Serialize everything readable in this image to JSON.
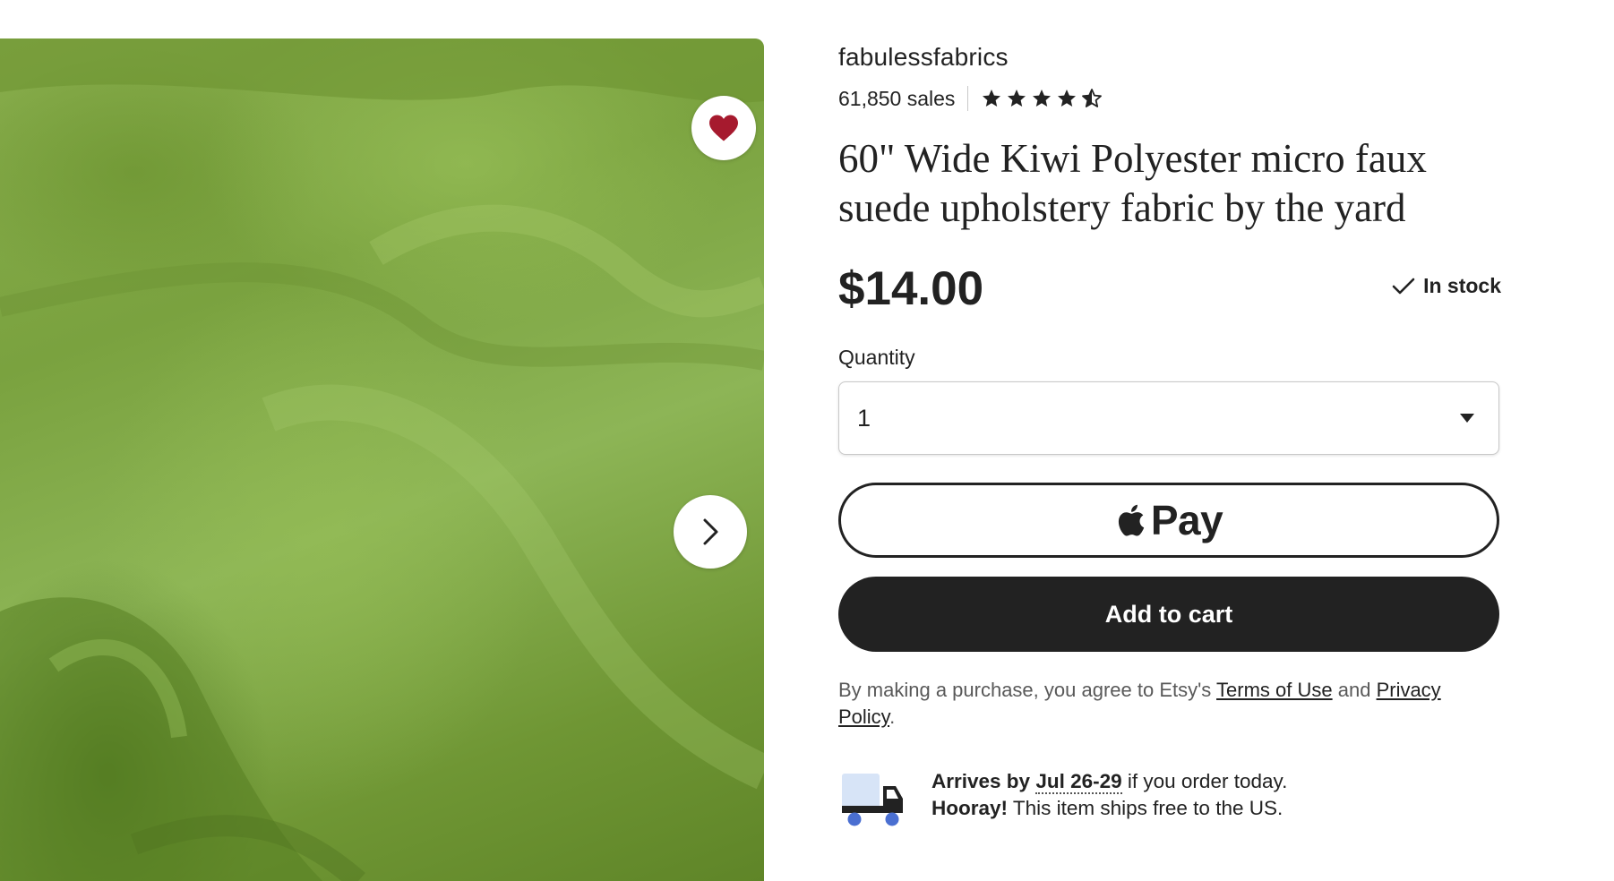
{
  "shop": {
    "name": "fabulessfabrics",
    "sales": "61,850 sales",
    "rating": 4.5
  },
  "product": {
    "title": "60\" Wide Kiwi Polyester micro faux suede upholstery fabric by the yard",
    "price": "$14.00",
    "stock": "In stock"
  },
  "quantity": {
    "label": "Quantity",
    "value": "1"
  },
  "buttons": {
    "apple_pay": "Pay",
    "add_to_cart": "Add to cart"
  },
  "legal": {
    "prefix": "By making a purchase, you agree to Etsy's ",
    "terms": "Terms of Use",
    "and": " and ",
    "privacy": "Privacy Policy",
    "suffix": "."
  },
  "delivery": {
    "arrives_label": "Arrives by",
    "date": "Jul 26-29",
    "arrives_suffix": " if you order today.",
    "hooray": "Hooray!",
    "free_text": " This item ships free to the US."
  },
  "icons": {
    "favorite": "heart-icon",
    "next": "chevron-right-icon",
    "dropdown": "caret-down-icon",
    "stock": "checkmark-icon",
    "apple": "apple-logo-icon",
    "delivery": "truck-icon"
  },
  "colors": {
    "heart": "#a61a2e",
    "primary": "#222222",
    "truck_blue": "#4a6fd1",
    "truck_light": "#d7e4f7",
    "fabric": "#7fa544"
  }
}
